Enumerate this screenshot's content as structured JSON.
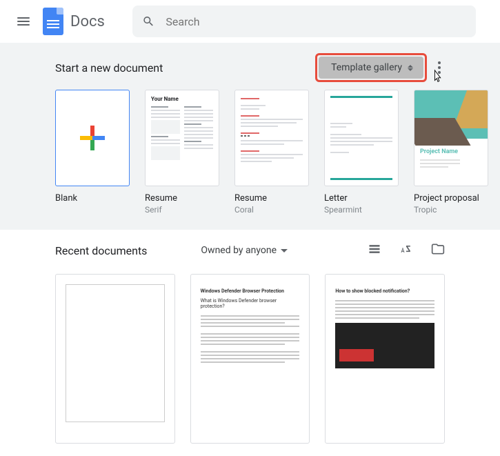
{
  "header": {
    "app_name": "Docs",
    "search_placeholder": "Search"
  },
  "templates": {
    "section_label": "Start a new document",
    "gallery_button": "Template gallery",
    "items": [
      {
        "title": "Blank",
        "subtitle": ""
      },
      {
        "title": "Resume",
        "subtitle": "Serif"
      },
      {
        "title": "Resume",
        "subtitle": "Coral"
      },
      {
        "title": "Letter",
        "subtitle": "Spearmint"
      },
      {
        "title": "Project proposal",
        "subtitle": "Tropic"
      }
    ],
    "proposal_thumb_title": "Project Name"
  },
  "recent": {
    "section_label": "Recent documents",
    "owned_by": "Owned by anyone"
  }
}
